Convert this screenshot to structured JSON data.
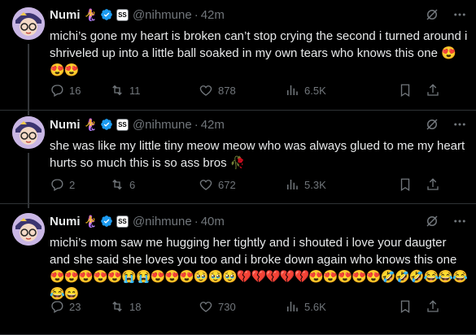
{
  "tweets": [
    {
      "name": "Numi",
      "name_emoji": "🧜‍♀️",
      "affiliate_label": "SS",
      "handle": "@nihmune",
      "time": "42m",
      "text": "michi’s gone my heart is broken can’t stop crying the second i turned around i shriveled up into a little ball soaked in my own tears who knows this one",
      "emojis": "😍😍😍",
      "replies": "16",
      "retweets": "11",
      "likes": "878",
      "views": "6.5K"
    },
    {
      "name": "Numi",
      "name_emoji": "🧜‍♀️",
      "affiliate_label": "SS",
      "handle": "@nihmune",
      "time": "42m",
      "text": "she was like my little tiny meow meow who was always glued to me my heart hurts so much this is so ass bros",
      "emojis": "🥀",
      "replies": "2",
      "retweets": "6",
      "likes": "672",
      "views": "5.3K"
    },
    {
      "name": "Numi",
      "name_emoji": "🧜‍♀️",
      "affiliate_label": "SS",
      "handle": "@nihmune",
      "time": "40m",
      "text": "michi’s mom saw me hugging her tightly and i shouted i love your daugter and she said she loves you too and i broke down again who knows this one",
      "emojis": "😍😍😍😍😍😭😭😍😍😍🥹🥹🥹💔💔💔💔💔😍😍😍😍😍🤣🤣🤣😂😂😂😂😄",
      "replies": "23",
      "retweets": "18",
      "likes": "730",
      "views": "5.6K"
    }
  ],
  "colors": {
    "background": "#000000",
    "text": "#e7e9ea",
    "muted": "#71767b",
    "verified": "#1d9bf0",
    "divider": "#2f3336"
  }
}
